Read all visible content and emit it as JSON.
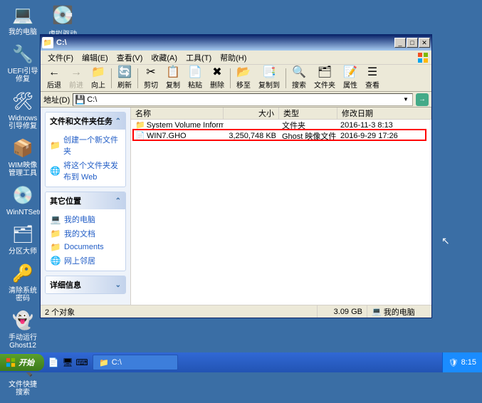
{
  "desktop": {
    "icons": [
      {
        "label": "我的电脑",
        "glyph": "💻"
      },
      {
        "label": "UEFI引导修复",
        "glyph": "🔧"
      },
      {
        "label": "Widnows引导修复",
        "glyph": "🛠"
      },
      {
        "label": "WIM映像管理工具",
        "glyph": "📦"
      },
      {
        "label": "WinNTSetup",
        "glyph": "💿"
      },
      {
        "label": "分区大师",
        "glyph": "🗂"
      },
      {
        "label": "清除系统密码",
        "glyph": "🔑"
      },
      {
        "label": "手动运行Ghost12",
        "glyph": "👻"
      },
      {
        "label": "文件快捷搜索",
        "glyph": "🔍"
      }
    ],
    "extra": {
      "label": "虚拟驱动器",
      "glyph": "💽"
    }
  },
  "window": {
    "title": "C:\\",
    "menu": [
      "文件(F)",
      "编辑(E)",
      "查看(V)",
      "收藏(A)",
      "工具(T)",
      "帮助(H)"
    ],
    "toolbar": [
      {
        "label": "后退",
        "glyph": "←",
        "disabled": false
      },
      {
        "label": "前进",
        "glyph": "→",
        "disabled": true
      },
      {
        "label": "向上",
        "glyph": "📁"
      },
      {
        "sep": true
      },
      {
        "label": "刷新",
        "glyph": "🔄"
      },
      {
        "sep": true
      },
      {
        "label": "剪切",
        "glyph": "✂"
      },
      {
        "label": "复制",
        "glyph": "📋"
      },
      {
        "label": "粘贴",
        "glyph": "📄"
      },
      {
        "label": "删除",
        "glyph": "✖"
      },
      {
        "sep": true
      },
      {
        "label": "移至",
        "glyph": "📂"
      },
      {
        "label": "复制到",
        "glyph": "📑"
      },
      {
        "sep": true
      },
      {
        "label": "搜索",
        "glyph": "🔍"
      },
      {
        "label": "文件夹",
        "glyph": "🗂"
      },
      {
        "label": "属性",
        "glyph": "📝"
      },
      {
        "label": "查看",
        "glyph": "☰"
      }
    ],
    "address_label": "地址(D)",
    "address_value": "C:\\",
    "panels": {
      "tasks": {
        "title": "文件和文件夹任务",
        "items": [
          {
            "glyph": "📁",
            "label": "创建一个新文件夹"
          },
          {
            "glyph": "🌐",
            "label": "将这个文件夹发布到 Web"
          }
        ]
      },
      "places": {
        "title": "其它位置",
        "items": [
          {
            "glyph": "💻",
            "label": "我的电脑"
          },
          {
            "glyph": "📁",
            "label": "我的文档"
          },
          {
            "glyph": "📁",
            "label": "Documents"
          },
          {
            "glyph": "🌐",
            "label": "网上邻居"
          }
        ]
      },
      "details": {
        "title": "详细信息"
      }
    },
    "columns": {
      "name": "名称",
      "size": "大小",
      "type": "类型",
      "date": "修改日期"
    },
    "files": [
      {
        "glyph": "📁",
        "name": "System Volume Information",
        "size": "",
        "type": "文件夹",
        "date": "2016-11-3 8:13"
      },
      {
        "glyph": "📄",
        "name": "WIN7.GHO",
        "size": "3,250,748 KB",
        "type": "Ghost 映像文件",
        "date": "2016-9-29 17:26"
      }
    ],
    "status": {
      "count": "2 个对象",
      "size": "3.09 GB",
      "location": "我的电脑"
    }
  },
  "taskbar": {
    "start": "开始",
    "task": "C:\\",
    "time": "8:15"
  }
}
